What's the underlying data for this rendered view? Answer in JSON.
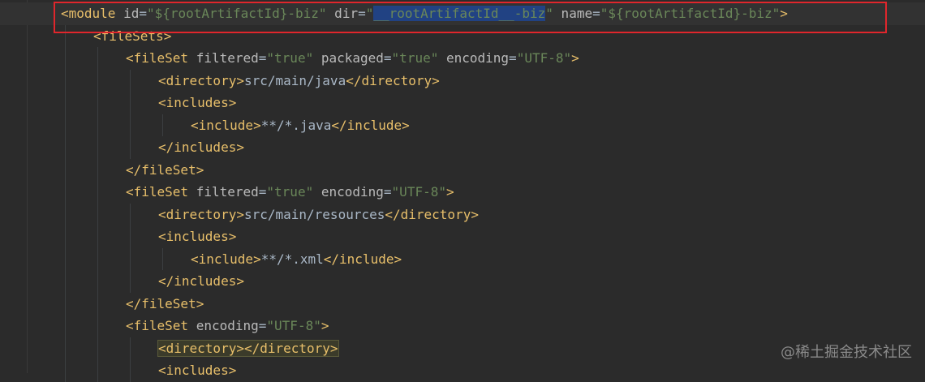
{
  "editor": {
    "lines": [
      {
        "indent": 1,
        "tokens": [
          {
            "t": "<module",
            "c": "tag"
          },
          {
            "t": " id",
            "c": "attr"
          },
          {
            "t": "=",
            "c": "txt"
          },
          {
            "t": "\"${rootArtifactId}-biz\"",
            "c": "str"
          },
          {
            "t": " dir",
            "c": "attr"
          },
          {
            "t": "=",
            "c": "txt"
          },
          {
            "t": "\"",
            "c": "str"
          },
          {
            "t": "__rootArtifactId__-biz",
            "c": "str sel"
          },
          {
            "t": "\"",
            "c": "str"
          },
          {
            "t": " name",
            "c": "attr"
          },
          {
            "t": "=",
            "c": "txt"
          },
          {
            "t": "\"${rootArtifactId}-biz\"",
            "c": "str"
          },
          {
            "t": ">",
            "c": "tag"
          }
        ]
      },
      {
        "indent": 2,
        "tokens": [
          {
            "t": "<fileSets>",
            "c": "tag"
          }
        ]
      },
      {
        "indent": 3,
        "tokens": [
          {
            "t": "<fileSet",
            "c": "tag"
          },
          {
            "t": " filtered",
            "c": "attr"
          },
          {
            "t": "=",
            "c": "txt"
          },
          {
            "t": "\"true\"",
            "c": "str"
          },
          {
            "t": " packaged",
            "c": "attr"
          },
          {
            "t": "=",
            "c": "txt"
          },
          {
            "t": "\"true\"",
            "c": "str"
          },
          {
            "t": " encoding",
            "c": "attr"
          },
          {
            "t": "=",
            "c": "txt"
          },
          {
            "t": "\"UTF-8\"",
            "c": "str"
          },
          {
            "t": ">",
            "c": "tag"
          }
        ]
      },
      {
        "indent": 4,
        "tokens": [
          {
            "t": "<directory>",
            "c": "tag"
          },
          {
            "t": "src/main/java",
            "c": "txt"
          },
          {
            "t": "</directory>",
            "c": "tag"
          }
        ]
      },
      {
        "indent": 4,
        "tokens": [
          {
            "t": "<includes>",
            "c": "tag"
          }
        ]
      },
      {
        "indent": 5,
        "tokens": [
          {
            "t": "<include>",
            "c": "tag"
          },
          {
            "t": "**/*.java",
            "c": "txt"
          },
          {
            "t": "</include>",
            "c": "tag"
          }
        ]
      },
      {
        "indent": 4,
        "tokens": [
          {
            "t": "</includes>",
            "c": "tag"
          }
        ]
      },
      {
        "indent": 3,
        "tokens": [
          {
            "t": "</fileSet>",
            "c": "tag"
          }
        ]
      },
      {
        "indent": 3,
        "tokens": [
          {
            "t": "<fileSet",
            "c": "tag"
          },
          {
            "t": " filtered",
            "c": "attr"
          },
          {
            "t": "=",
            "c": "txt"
          },
          {
            "t": "\"true\"",
            "c": "str"
          },
          {
            "t": " encoding",
            "c": "attr"
          },
          {
            "t": "=",
            "c": "txt"
          },
          {
            "t": "\"UTF-8\"",
            "c": "str"
          },
          {
            "t": ">",
            "c": "tag"
          }
        ]
      },
      {
        "indent": 4,
        "tokens": [
          {
            "t": "<directory>",
            "c": "tag"
          },
          {
            "t": "src/main/resources",
            "c": "txt"
          },
          {
            "t": "</directory>",
            "c": "tag"
          }
        ]
      },
      {
        "indent": 4,
        "tokens": [
          {
            "t": "<includes>",
            "c": "tag"
          }
        ]
      },
      {
        "indent": 5,
        "tokens": [
          {
            "t": "<include>",
            "c": "tag"
          },
          {
            "t": "**/*.xml",
            "c": "txt"
          },
          {
            "t": "</include>",
            "c": "tag"
          }
        ]
      },
      {
        "indent": 4,
        "tokens": [
          {
            "t": "</includes>",
            "c": "tag"
          }
        ]
      },
      {
        "indent": 3,
        "tokens": [
          {
            "t": "</fileSet>",
            "c": "tag"
          }
        ]
      },
      {
        "indent": 3,
        "tokens": [
          {
            "t": "<fileSet",
            "c": "tag"
          },
          {
            "t": " encoding",
            "c": "attr"
          },
          {
            "t": "=",
            "c": "txt"
          },
          {
            "t": "\"UTF-8\"",
            "c": "str"
          },
          {
            "t": ">",
            "c": "tag"
          }
        ]
      },
      {
        "indent": 4,
        "tokens": [
          {
            "t": "<directory></directory>",
            "c": "tag match"
          }
        ]
      },
      {
        "indent": 4,
        "tokens": [
          {
            "t": "<includes>",
            "c": "tag"
          }
        ]
      }
    ]
  },
  "watermark": "@稀土掘金技术社区",
  "colors": {
    "background": "#2b2b2b",
    "tag": "#e8bf6a",
    "attribute": "#bababa",
    "string": "#6a8759",
    "text": "#a9b7c6",
    "selection": "#214283",
    "highlight_box": "#e0262c"
  }
}
